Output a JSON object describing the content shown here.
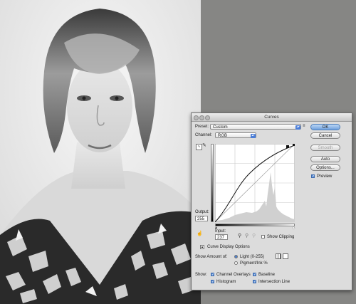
{
  "dialog": {
    "title": "Curves",
    "preset_label": "Preset:",
    "preset_value": "Custom",
    "channel_label": "Channel:",
    "channel_value": "RGB",
    "output_label": "Output:",
    "output_value": "255",
    "input_label": "Input:",
    "input_value": "237",
    "show_clipping_label": "Show Clipping",
    "curve_display_options_label": "Curve Display Options",
    "show_amount_label": "Show Amount of:",
    "light_label": "Light (0-255)",
    "pigment_label": "Pigment/Ink %",
    "show_label": "Show:",
    "channel_overlays_label": "Channel Overlays",
    "baseline_label": "Baseline",
    "histogram_label": "Histogram",
    "intersection_line_label": "Intersection Line",
    "preview_label": "Preview",
    "preset_options_glyph": "≡",
    "check_glyph": "✓"
  },
  "buttons": {
    "ok": "OK",
    "cancel": "Cancel",
    "smooth": "Smooth",
    "auto": "Auto",
    "options": "Options..."
  },
  "icons": {
    "curve_edit": "curve-point-icon",
    "pencil": "pencil-icon",
    "black_eyedropper": "black-eyedropper-icon",
    "gray_eyedropper": "gray-eyedropper-icon",
    "white_eyedropper": "white-eyedropper-icon",
    "target_adjust": "on-image-adjust-icon",
    "expand": "disclosure-icon",
    "grid_simple": "simple-grid-icon",
    "grid_detailed": "detailed-grid-icon"
  },
  "state": {
    "show_clipping": false,
    "light_selected": true,
    "channel_overlays": true,
    "baseline": true,
    "histogram": true,
    "intersection_line": true,
    "preview": true
  },
  "colors": {
    "ok_button": "#6fa1dd",
    "background": "#868684"
  }
}
